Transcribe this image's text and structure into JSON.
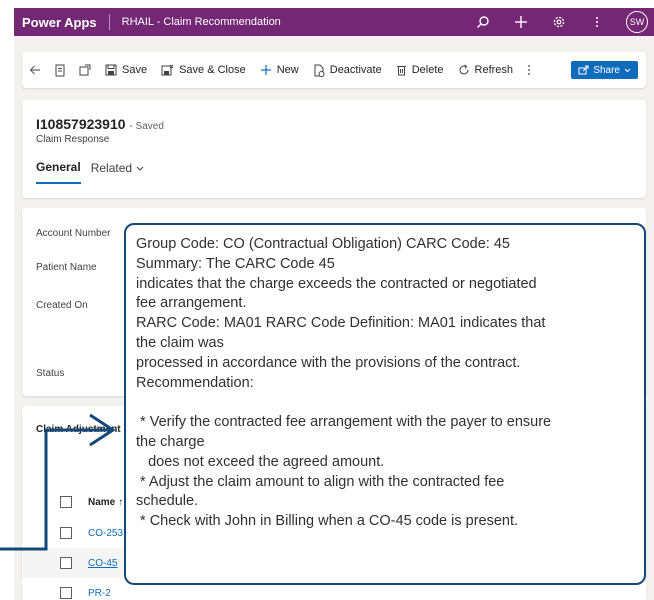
{
  "topbar": {
    "brand": "Power Apps",
    "app_name": "RHAIL - Claim Recommendation",
    "avatar_initials": "SW",
    "color": "#742774"
  },
  "commands": {
    "save": "Save",
    "save_close": "Save & Close",
    "new": "New",
    "deactivate": "Deactivate",
    "delete": "Delete",
    "refresh": "Refresh",
    "share": "Share"
  },
  "record": {
    "id": "I10857923910",
    "status_text": "- Saved",
    "entity": "Claim Response",
    "tabs": [
      "General",
      "Related"
    ]
  },
  "form": {
    "fields": [
      "Account Number",
      "Patient Name",
      "Created On",
      "Status"
    ]
  },
  "grid": {
    "title": "Claim Adjustment",
    "column_name": "Name",
    "sort_indicator": "↑",
    "rows": [
      "CO-253",
      "CO-45",
      "PR-2"
    ]
  },
  "callout": {
    "lines": [
      "Group Code: CO (Contractual Obligation) CARC Code: 45",
      "Summary: The CARC Code 45",
      "indicates that the charge exceeds the contracted or negotiated",
      "fee arrangement.",
      "RARC Code: MA01 RARC Code Definition: MA01 indicates that",
      "the claim was",
      "processed in accordance with the provisions of the contract.",
      "Recommendation:",
      "",
      " * Verify the contracted fee arrangement with the payer to ensure",
      "the charge",
      "   does not exceed the agreed amount.",
      " * Adjust the claim amount to align with the contracted fee",
      "schedule.",
      " * Check with John in Billing when a CO-45 code is present."
    ],
    "border_color": "#14477a"
  }
}
